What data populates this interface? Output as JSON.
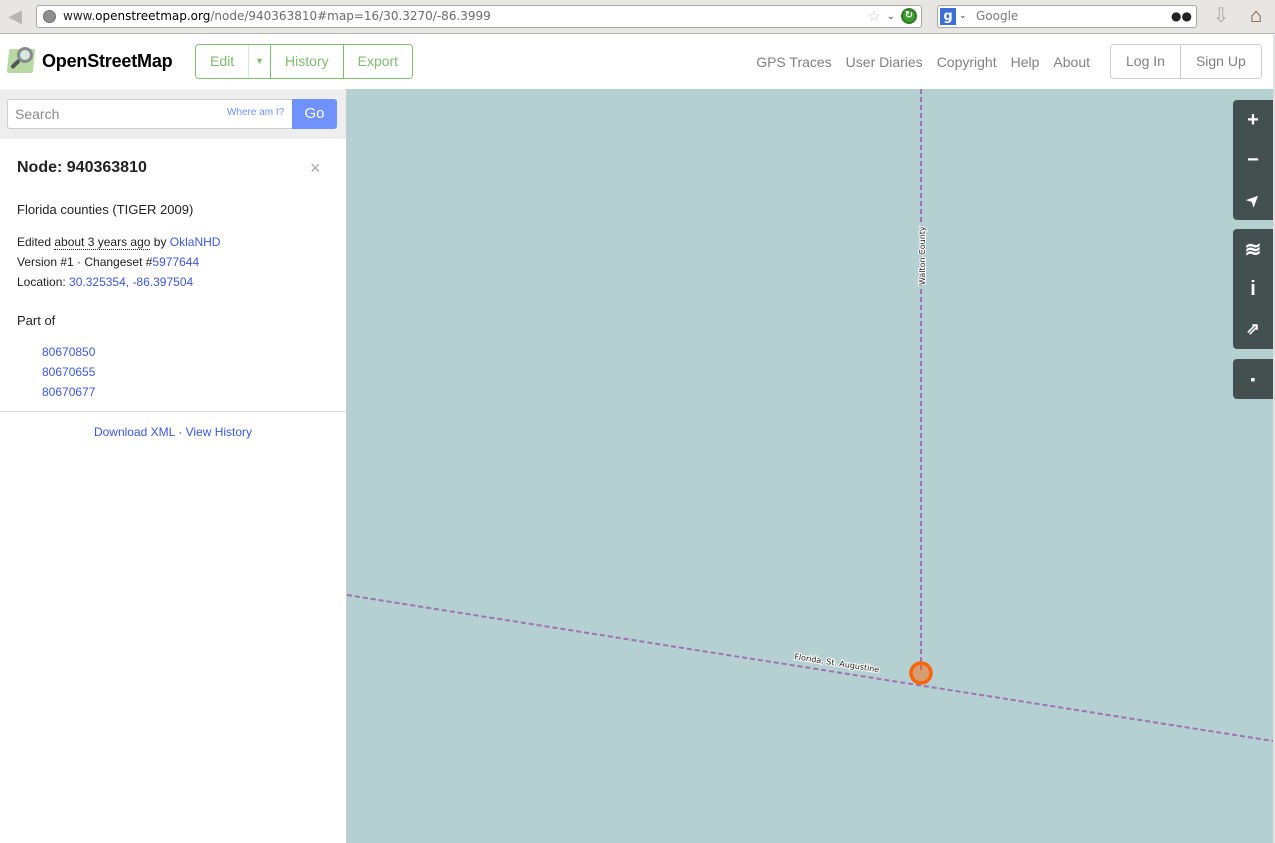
{
  "browser": {
    "url_prefix": "www.",
    "url_host": "openstreetmap.org",
    "url_path": "/node/940363810#map=16/30.3270/-86.3999",
    "search_engine_placeholder": "Google",
    "back_icon": "◀",
    "star_icon": "☆",
    "dropdown_icon": "⌄",
    "reload_icon": "↻",
    "search_icon": "🔍",
    "download_icon": "⇩",
    "home_icon": "⌂"
  },
  "header": {
    "brand": "OpenStreetMap",
    "edit_label": "Edit",
    "edit_caret": "▼",
    "history_label": "History",
    "export_label": "Export",
    "nav": [
      "GPS Traces",
      "User Diaries",
      "Copyright",
      "Help",
      "About"
    ],
    "login_label": "Log In",
    "signup_label": "Sign Up"
  },
  "sidebar": {
    "search_placeholder": "Search",
    "where_am_i": "Where am I?",
    "go_label": "Go",
    "title": "Node: 940363810",
    "close_icon": "×",
    "name": "Florida counties (TIGER 2009)",
    "edited_prefix": "Edited ",
    "edited_time": "about 3 years ago",
    "edited_by": " by ",
    "editor": "OklaNHD",
    "version_text": "Version #1 · Changeset #",
    "changeset": "5977644",
    "location_label": "Location: ",
    "location": "30.325354, -86.397504",
    "part_of_label": "Part of",
    "part_of": [
      "80670850",
      "80670655",
      "80670677"
    ],
    "download_xml": "Download XML",
    "separator": " · ",
    "view_history": "View History"
  },
  "map": {
    "labels": {
      "vertical": "Walton County",
      "horizontal": "Florida, St. Augustine"
    },
    "colors": {
      "water": "#b5d0d0",
      "boundary": "#a070b8",
      "marker": "#ff6200"
    },
    "controls": {
      "zoom_in": "+",
      "zoom_out": "−",
      "locate": "➤",
      "layers": "≋",
      "info": "i",
      "share": "⇗",
      "note": "▪"
    }
  },
  "colors": {
    "brand_green": "#7ebc6f",
    "link_blue": "#3c58d8",
    "go_blue": "#7092ff",
    "control_bg": "#444f4f"
  }
}
